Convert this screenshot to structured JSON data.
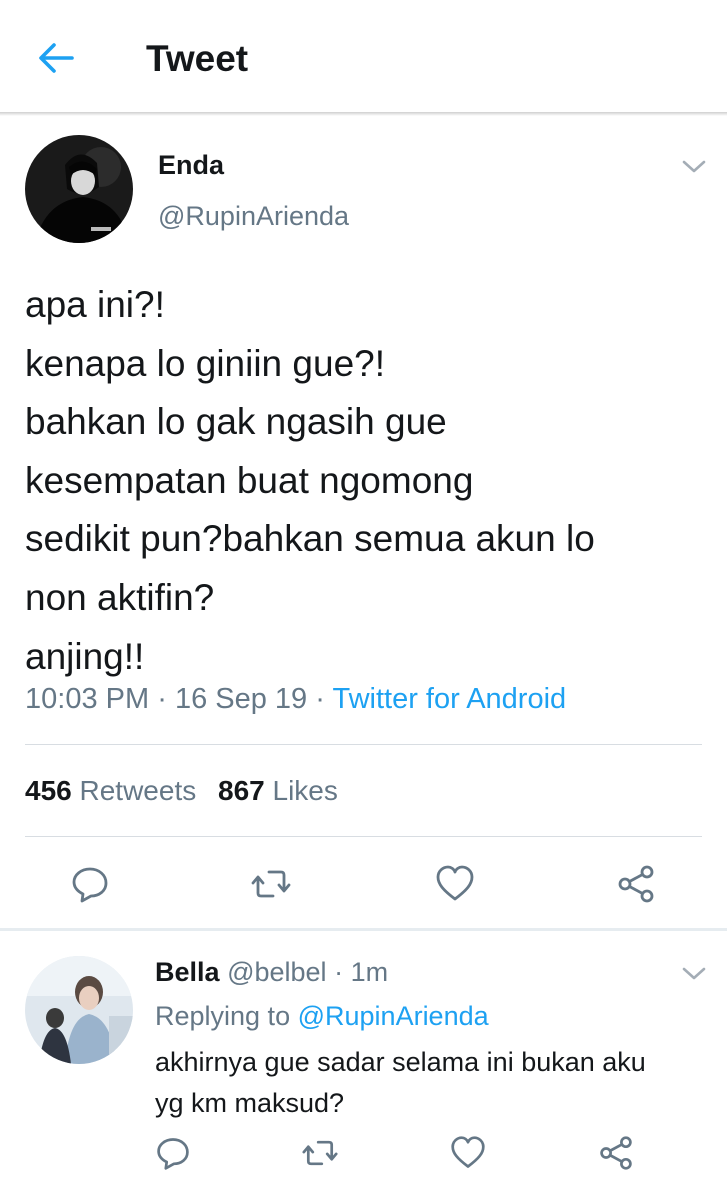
{
  "header": {
    "title": "Tweet"
  },
  "tweet": {
    "author_name": "Enda",
    "author_handle": "@RupinArienda",
    "lines": [
      "apa ini?!",
      "kenapa lo giniin gue?!",
      "bahkan lo gak ngasih gue",
      "kesempatan buat ngomong",
      "sedikit pun?bahkan semua akun lo",
      "non aktifin?",
      "anjing!!"
    ],
    "time": "10:03 PM",
    "date": "16 Sep 19",
    "separator": "·",
    "source": "Twitter for Android",
    "retweet_count": "456",
    "retweet_label": "Retweets",
    "like_count": "867",
    "like_label": "Likes"
  },
  "reply": {
    "author_name": "Bella",
    "author_handle": "@belbel",
    "separator": "·",
    "time_ago": "1m",
    "replying_label": "Replying to",
    "replying_handle": "@RupinArienda",
    "lines": [
      "akhirnya gue sadar selama ini bukan aku",
      "yg km maksud?"
    ]
  },
  "colors": {
    "accent": "#1da1f2",
    "muted": "#657786",
    "text": "#14171a",
    "divider": "#d8dde2"
  },
  "icons": [
    "back-arrow-icon",
    "chevron-down-icon",
    "reply-icon",
    "retweet-icon",
    "like-icon",
    "share-icon"
  ]
}
